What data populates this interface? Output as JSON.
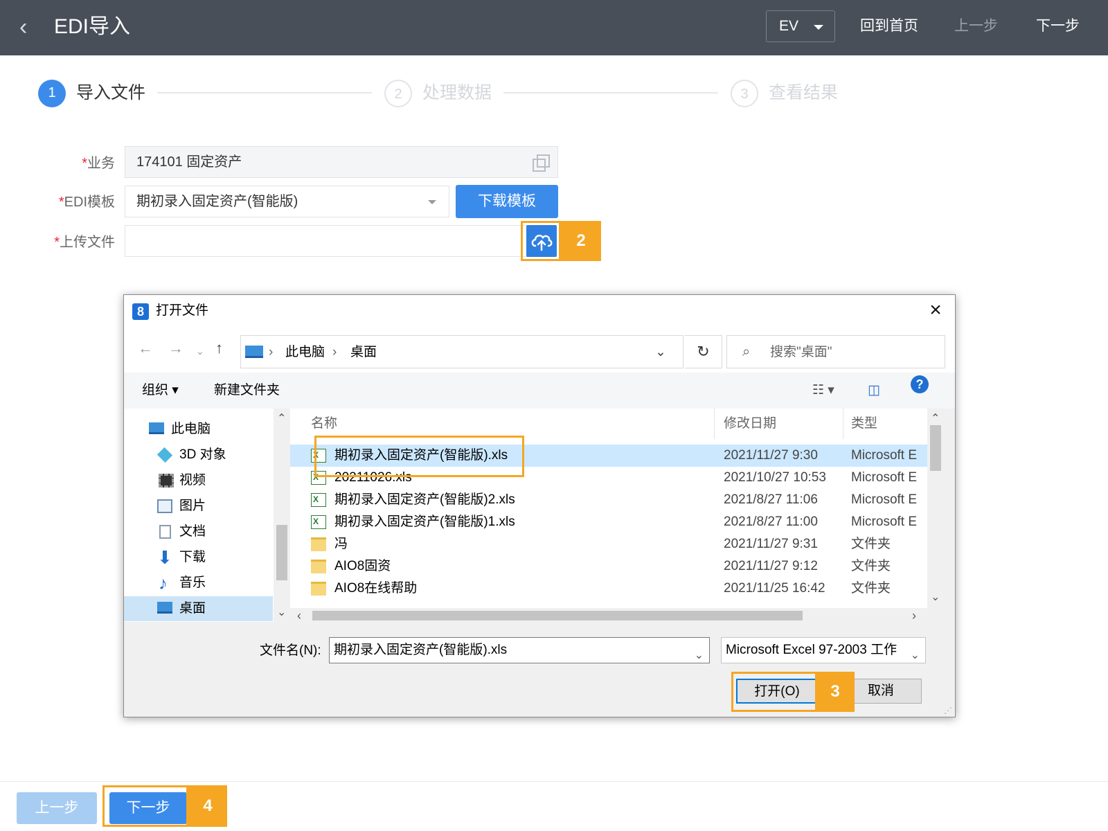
{
  "topbar": {
    "title": "EDI导入",
    "env_select": "EV",
    "home": "回到首页",
    "prev": "上一步",
    "next": "下一步"
  },
  "steps": [
    {
      "num": "1",
      "label": "导入文件",
      "state": "active"
    },
    {
      "num": "2",
      "label": "处理数据",
      "state": "idle"
    },
    {
      "num": "3",
      "label": "查看结果",
      "state": "idle"
    }
  ],
  "form": {
    "business_label": "业务",
    "business_value": "174101 固定资产",
    "template_label": "EDI模板",
    "template_value": "期初录入固定资产(智能版)",
    "download_button": "下载模板",
    "upload_label": "上传文件",
    "upload_value": ""
  },
  "annotations": {
    "a2": "2",
    "a3": "3",
    "a4": "4"
  },
  "dialog": {
    "title": "打开文件",
    "breadcrumb": [
      "此电脑",
      "桌面"
    ],
    "search_placeholder": "搜索\"桌面\"",
    "organize": "组织",
    "new_folder": "新建文件夹",
    "help": "?",
    "tree": [
      {
        "label": "此电脑",
        "icon": "computer-icon",
        "selected": false
      },
      {
        "label": "3D 对象",
        "icon": "cube-icon",
        "selected": false
      },
      {
        "label": "视频",
        "icon": "video-icon",
        "selected": false
      },
      {
        "label": "图片",
        "icon": "picture-icon",
        "selected": false
      },
      {
        "label": "文档",
        "icon": "document-icon",
        "selected": false
      },
      {
        "label": "下载",
        "icon": "download-icon",
        "selected": false
      },
      {
        "label": "音乐",
        "icon": "music-icon",
        "selected": false
      },
      {
        "label": "桌面",
        "icon": "desktop-icon",
        "selected": true
      }
    ],
    "columns": {
      "name": "名称",
      "date": "修改日期",
      "type": "类型"
    },
    "files": [
      {
        "name": "期初录入固定资产(智能版).xls",
        "date": "2021/11/27 9:30",
        "type": "Microsoft E",
        "kind": "xls",
        "selected": true
      },
      {
        "name": "20211026.xls",
        "date": "2021/10/27 10:53",
        "type": "Microsoft E",
        "kind": "xls",
        "selected": false
      },
      {
        "name": "期初录入固定资产(智能版)2.xls",
        "date": "2021/8/27 11:06",
        "type": "Microsoft E",
        "kind": "xls",
        "selected": false
      },
      {
        "name": "期初录入固定资产(智能版)1.xls",
        "date": "2021/8/27 11:00",
        "type": "Microsoft E",
        "kind": "xls",
        "selected": false
      },
      {
        "name": "冯",
        "date": "2021/11/27 9:31",
        "type": "文件夹",
        "kind": "folder",
        "selected": false
      },
      {
        "name": "AIO8固资",
        "date": "2021/11/27 9:12",
        "type": "文件夹",
        "kind": "folder",
        "selected": false
      },
      {
        "name": "AIO8在线帮助",
        "date": "2021/11/25 16:42",
        "type": "文件夹",
        "kind": "folder",
        "selected": false
      }
    ],
    "filename_label": "文件名(N):",
    "filename_value": "期初录入固定资产(智能版).xls",
    "filetype_value": "Microsoft Excel 97-2003 工作",
    "open_button": "打开(O)",
    "cancel_button": "取消"
  },
  "footer": {
    "prev": "上一步",
    "next": "下一步"
  },
  "colors": {
    "topbar": "#484f58",
    "primary": "#3b8beb",
    "highlight": "#f5a623",
    "selection": "#cce8ff"
  }
}
